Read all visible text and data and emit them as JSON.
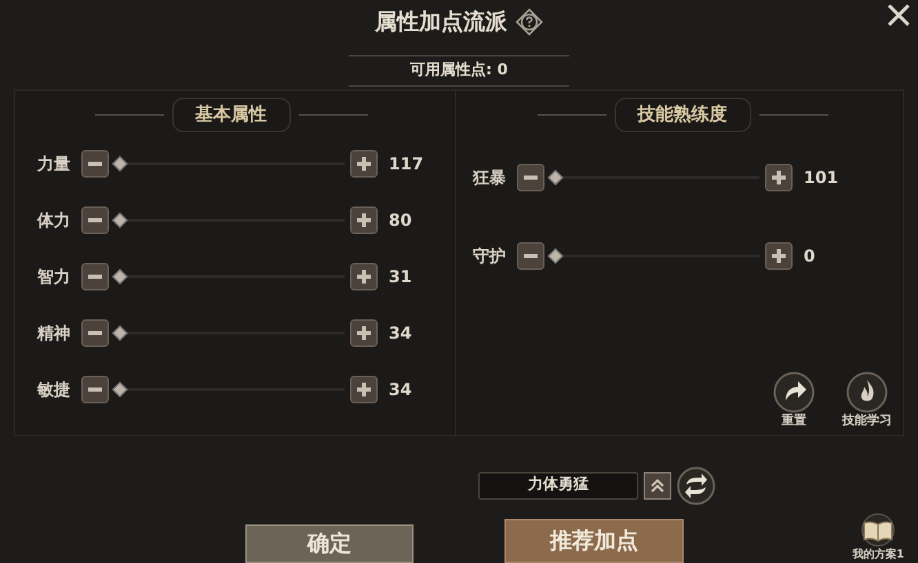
{
  "window": {
    "title": "属性加点流派"
  },
  "available_points": "可用属性点: 0",
  "basic_attributes": {
    "title": "基本属性",
    "rows": [
      {
        "name": "力量",
        "level": 0,
        "value": "117"
      },
      {
        "name": "体力",
        "level": 0,
        "value": "80"
      },
      {
        "name": "智力",
        "level": 0,
        "value": "31"
      },
      {
        "name": "精神",
        "level": 0,
        "value": "34"
      },
      {
        "name": "敏捷",
        "level": 0,
        "value": "34"
      }
    ]
  },
  "skill_proficiency": {
    "title": "技能熟练度",
    "rows": [
      {
        "name": "狂暴",
        "level": 0,
        "value": "101"
      },
      {
        "name": "守护",
        "level": 0,
        "value": "0"
      }
    ],
    "actions": [
      {
        "kind": "reset",
        "label": "重置"
      },
      {
        "kind": "learn",
        "label": "技能学习"
      }
    ]
  },
  "preset": {
    "value": "力体勇猛"
  },
  "buttons": [
    {
      "kind": "confirm",
      "label": "确定"
    },
    {
      "kind": "recommend",
      "label": "推荐加点"
    }
  ],
  "my_plan": {
    "label": "我的方案1"
  }
}
